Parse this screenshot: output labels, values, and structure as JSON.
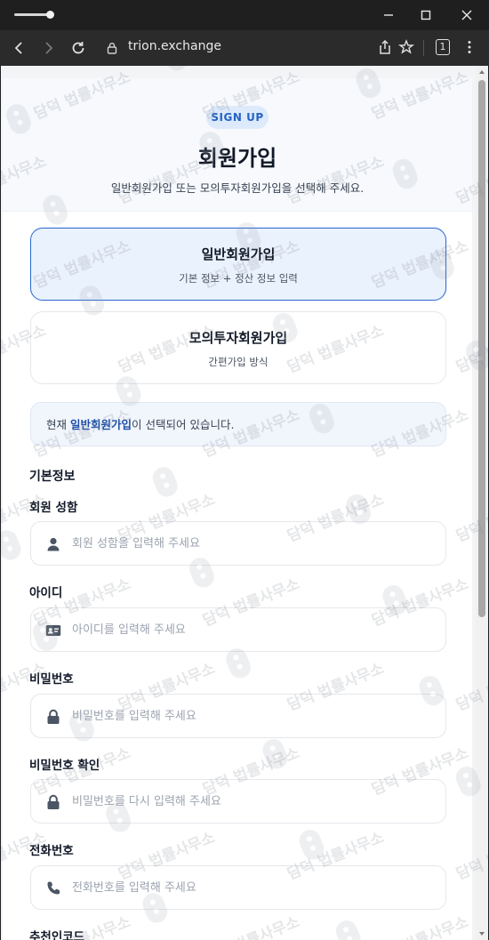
{
  "browser": {
    "url": "trion.exchange",
    "tab_count": "1"
  },
  "header": {
    "badge": "SIGN UP",
    "title": "회원가입",
    "subtitle": "일반회원가입 또는 모의투자회원가입을 선택해 주세요."
  },
  "signup_types": [
    {
      "title": "일반회원가입",
      "desc": "기본 정보 + 정산 정보 입력",
      "selected": true
    },
    {
      "title": "모의투자회원가입",
      "desc": "간편가입 방식",
      "selected": false
    }
  ],
  "notice": {
    "prefix": "현재 ",
    "highlight": "일반회원가입",
    "suffix": "이 선택되어 있습니다."
  },
  "section_title": "기본정보",
  "fields": [
    {
      "label": "회원 성함",
      "placeholder": "회원 성함을 입력해 주세요",
      "icon": "user-icon"
    },
    {
      "label": "아이디",
      "placeholder": "아이디를 입력해 주세요",
      "icon": "id-card-icon"
    },
    {
      "label": "비밀번호",
      "placeholder": "비밀번호를 입력해 주세요",
      "icon": "lock-icon"
    },
    {
      "label": "비밀번호 확인",
      "placeholder": "비밀번호를 다시 입력해 주세요",
      "icon": "lock-icon"
    },
    {
      "label": "전화번호",
      "placeholder": "전화번호를 입력해 주세요",
      "icon": "phone-icon"
    },
    {
      "label": "추천인코드"
    }
  ],
  "watermark": {
    "text": "담덕 법률사무소"
  },
  "colors": {
    "accent": "#2e6bd2",
    "selected_bg": "#eaf2fd",
    "badge_bg": "#dceafb",
    "badge_text": "#2563c4",
    "highlight_text": "#1e4fa8"
  }
}
